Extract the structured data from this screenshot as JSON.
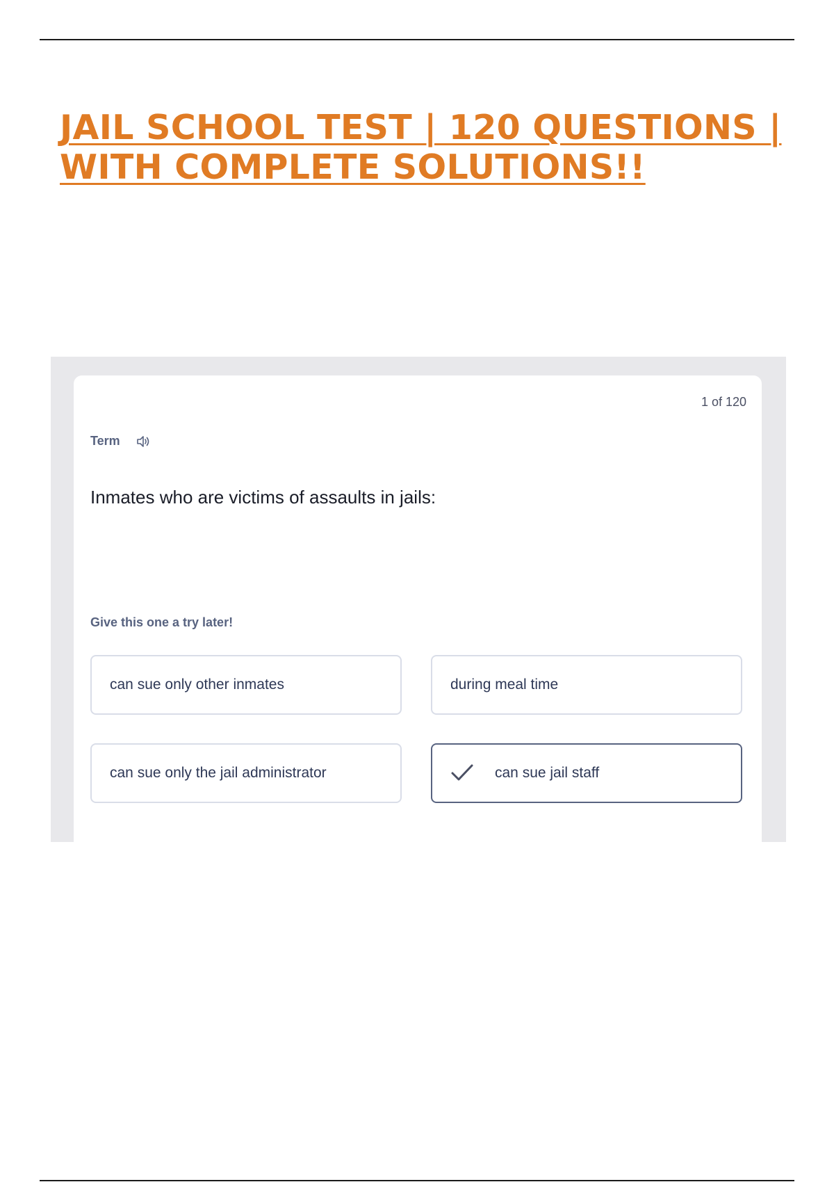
{
  "document": {
    "title_line1": "JAIL SCHOOL TEST | 120 QUESTIONS |",
    "title_line2": "WITH COMPLETE SOLUTIONS!!"
  },
  "flashcard": {
    "counter": "1 of 120",
    "side_label": "Term",
    "audio_icon": "speaker-icon",
    "question": "Inmates who are victims of assaults in jails:",
    "hint": "Give this one a try later!",
    "options": [
      "can sue only other inmates",
      "during meal time",
      "can sue only the jail administrator",
      "can sue jail staff"
    ],
    "correct_option_index": 3,
    "correct_icon": "checkmark-icon"
  },
  "colors": {
    "title": "#e07b24",
    "panel_bg": "#e8e8eb",
    "muted_text": "#586380",
    "option_border": "#d9dde8",
    "selected_border": "#586380"
  }
}
